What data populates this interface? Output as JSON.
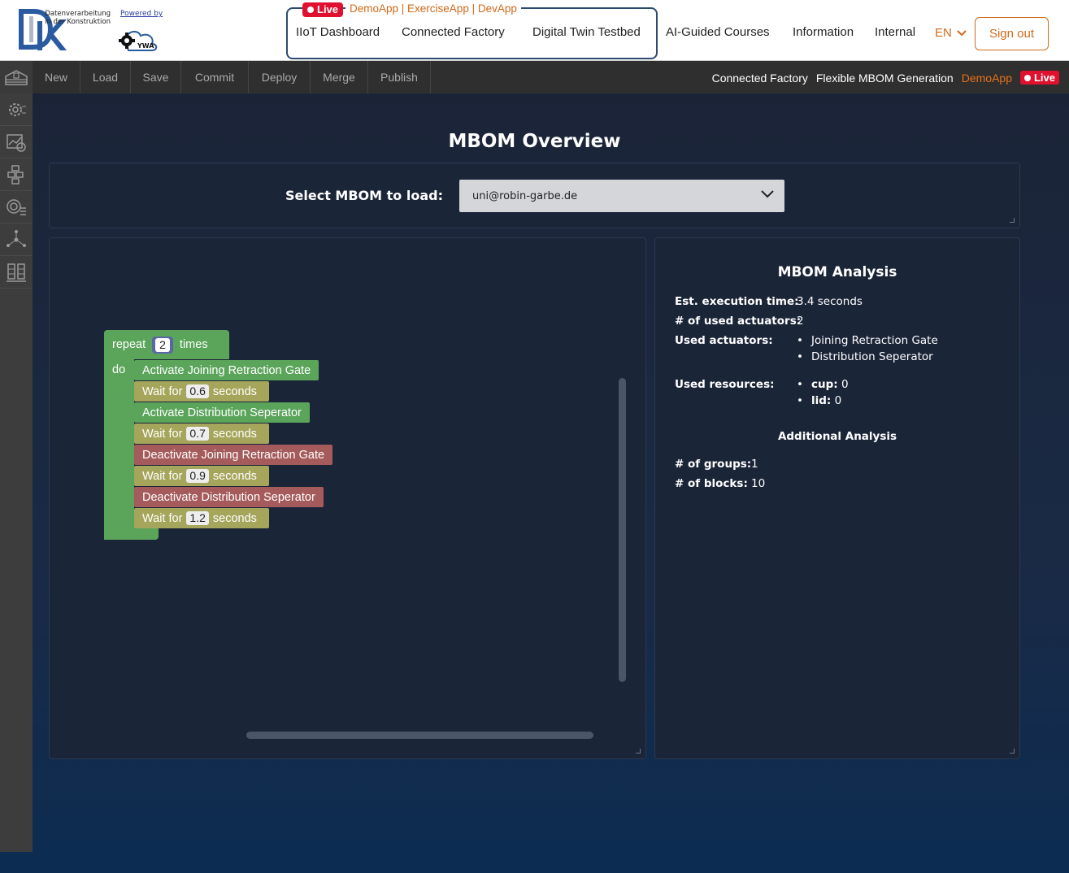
{
  "header": {
    "logo_text": "Datenverarbeitung in der Konstruktion",
    "powered_by": "Powered by",
    "ywa_label": "YWA",
    "live_label": "Live",
    "env_links": "DemoApp | ExerciseApp | DevApp",
    "nav": [
      "IIoT Dashboard",
      "Connected Factory",
      "Digital Twin Testbed",
      "AI-Guided Courses",
      "Information",
      "Internal"
    ],
    "language": "EN",
    "sign_out": "Sign out"
  },
  "toolbar": {
    "buttons": [
      "New",
      "Load",
      "Save",
      "Commit",
      "Deploy",
      "Merge",
      "Publish"
    ],
    "breadcrumb_1": "Connected Factory",
    "breadcrumb_2": "Flexible MBOM Generation",
    "app_env": "DemoApp",
    "live_label": "Live"
  },
  "sidebar": {
    "icons": [
      "factory-home-icon",
      "settings-gear-icon",
      "analytics-chart-icon",
      "hierarchy-blocks-icon",
      "target-list-icon",
      "network-nodes-icon",
      "server-rack-icon"
    ]
  },
  "main": {
    "title": "MBOM Overview",
    "select_label": "Select MBOM to load:",
    "select_value": "uni@robin-garbe.de"
  },
  "blocks": {
    "repeat_label": "repeat",
    "repeat_count": "2",
    "times_label": "times",
    "do_label": "do",
    "items": [
      {
        "type": "action",
        "text": "Activate Joining Retraction Gate"
      },
      {
        "type": "wait",
        "pre": "Wait for",
        "value": "0.6",
        "post": "seconds"
      },
      {
        "type": "action",
        "text": "Activate Distribution Seperator"
      },
      {
        "type": "wait",
        "pre": "Wait for",
        "value": "0.7",
        "post": "seconds"
      },
      {
        "type": "deactivate",
        "text": "Deactivate Joining Retraction Gate"
      },
      {
        "type": "wait",
        "pre": "Wait for",
        "value": "0.9",
        "post": "seconds"
      },
      {
        "type": "deactivate",
        "text": "Deactivate Distribution Seperator"
      },
      {
        "type": "wait",
        "pre": "Wait for",
        "value": "1.2",
        "post": "seconds"
      }
    ]
  },
  "analysis": {
    "title": "MBOM Analysis",
    "exec_time_label": "Est. execution time:",
    "exec_time_value": "3.4 seconds",
    "actuators_count_label": "# of used actuators:",
    "actuators_count_value": "2",
    "actuators_label": "Used actuators:",
    "actuators": [
      "Joining Retraction Gate",
      "Distribution Seperator"
    ],
    "resources_label": "Used resources:",
    "resources": [
      {
        "name": "cup:",
        "value": "0"
      },
      {
        "name": "lid:",
        "value": "0"
      }
    ],
    "additional_title": "Additional Analysis",
    "groups_label": "# of groups:",
    "groups_value": "1",
    "blocks_label": "# of blocks:",
    "blocks_value": "10"
  },
  "colors": {
    "accent_orange": "#d06a1a",
    "live_red": "#e0102f",
    "block_green": "#5ba55b",
    "block_olive": "#a5a55b",
    "block_red": "#a55b5b",
    "repeat_num_blue": "#5b67a5"
  }
}
